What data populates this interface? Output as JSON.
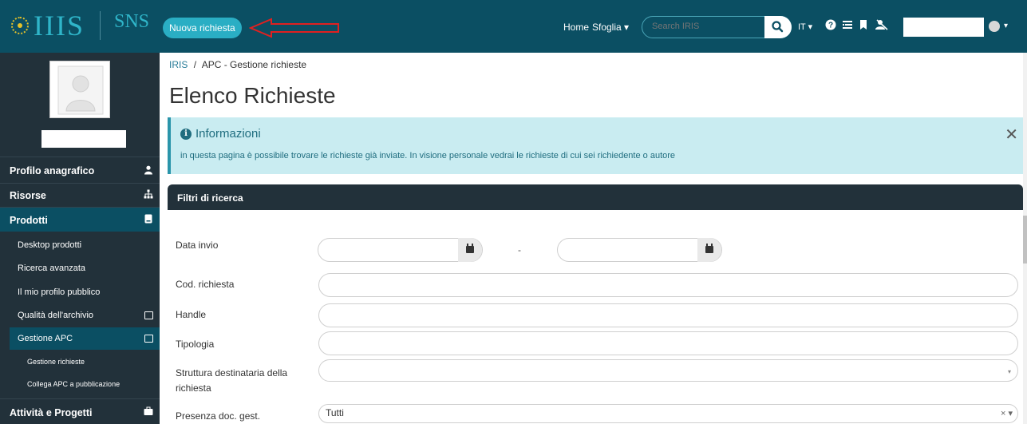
{
  "header": {
    "logo_text": "IIIS",
    "sns_label": "SNS",
    "new_request_label": "Nuova richiesta",
    "home_label": "Home",
    "browse_label": "Sfoglia ▾",
    "search_placeholder": "Search IRIS",
    "language_label": "IT ▾",
    "user_caret": "▾"
  },
  "sidebar": {
    "items": [
      {
        "label": "Profilo anagrafico",
        "icon": "user-icon"
      },
      {
        "label": "Risorse",
        "icon": "sitemap-icon"
      },
      {
        "label": "Prodotti",
        "icon": "book-icon"
      },
      {
        "label": "Attività e Progetti",
        "icon": "briefcase-icon"
      }
    ],
    "sub_items": [
      {
        "label": "Desktop prodotti"
      },
      {
        "label": "Ricerca avanzata"
      },
      {
        "label": "Il mio profilo pubblico"
      },
      {
        "label": "Qualità dell'archivio",
        "icon": "folder-icon"
      },
      {
        "label": "Gestione APC",
        "icon": "folder-icon"
      }
    ],
    "subsub_items": [
      {
        "label": "Gestione richieste"
      },
      {
        "label": "Collega APC a pubblicazione"
      }
    ]
  },
  "breadcrumb": {
    "root": "IRIS",
    "separator": "/",
    "current": "APC - Gestione richieste"
  },
  "page_title": "Elenco Richieste",
  "info_alert": {
    "title": "Informazioni",
    "info_glyph": "i",
    "text": "in questa pagina è possibile trovare le richieste già inviate. In visione personale vedrai le richieste di cui sei richiedente o autore",
    "close_glyph": "✕"
  },
  "filters": {
    "title": "Filtri di ricerca",
    "data_invio": "Data invio",
    "range_separator": "-",
    "cod_richiesta": "Cod. richiesta",
    "handle": "Handle",
    "tipologia": "Tipologia",
    "struttura_line1": "Struttura destinataria della",
    "struttura_line2": "richiesta",
    "presenza": "Presenza doc. gest.",
    "presenza_value": "Tutti",
    "clear_glyph": "× ▾",
    "caret_glyph": "▾"
  },
  "colors": {
    "topbar": "#0b4f63",
    "accent": "#2aaec4",
    "sidebar": "#22313a",
    "sidebar_active": "#0b4f63",
    "alert_bg": "#c9ecf1",
    "arrow": "#e02020"
  }
}
